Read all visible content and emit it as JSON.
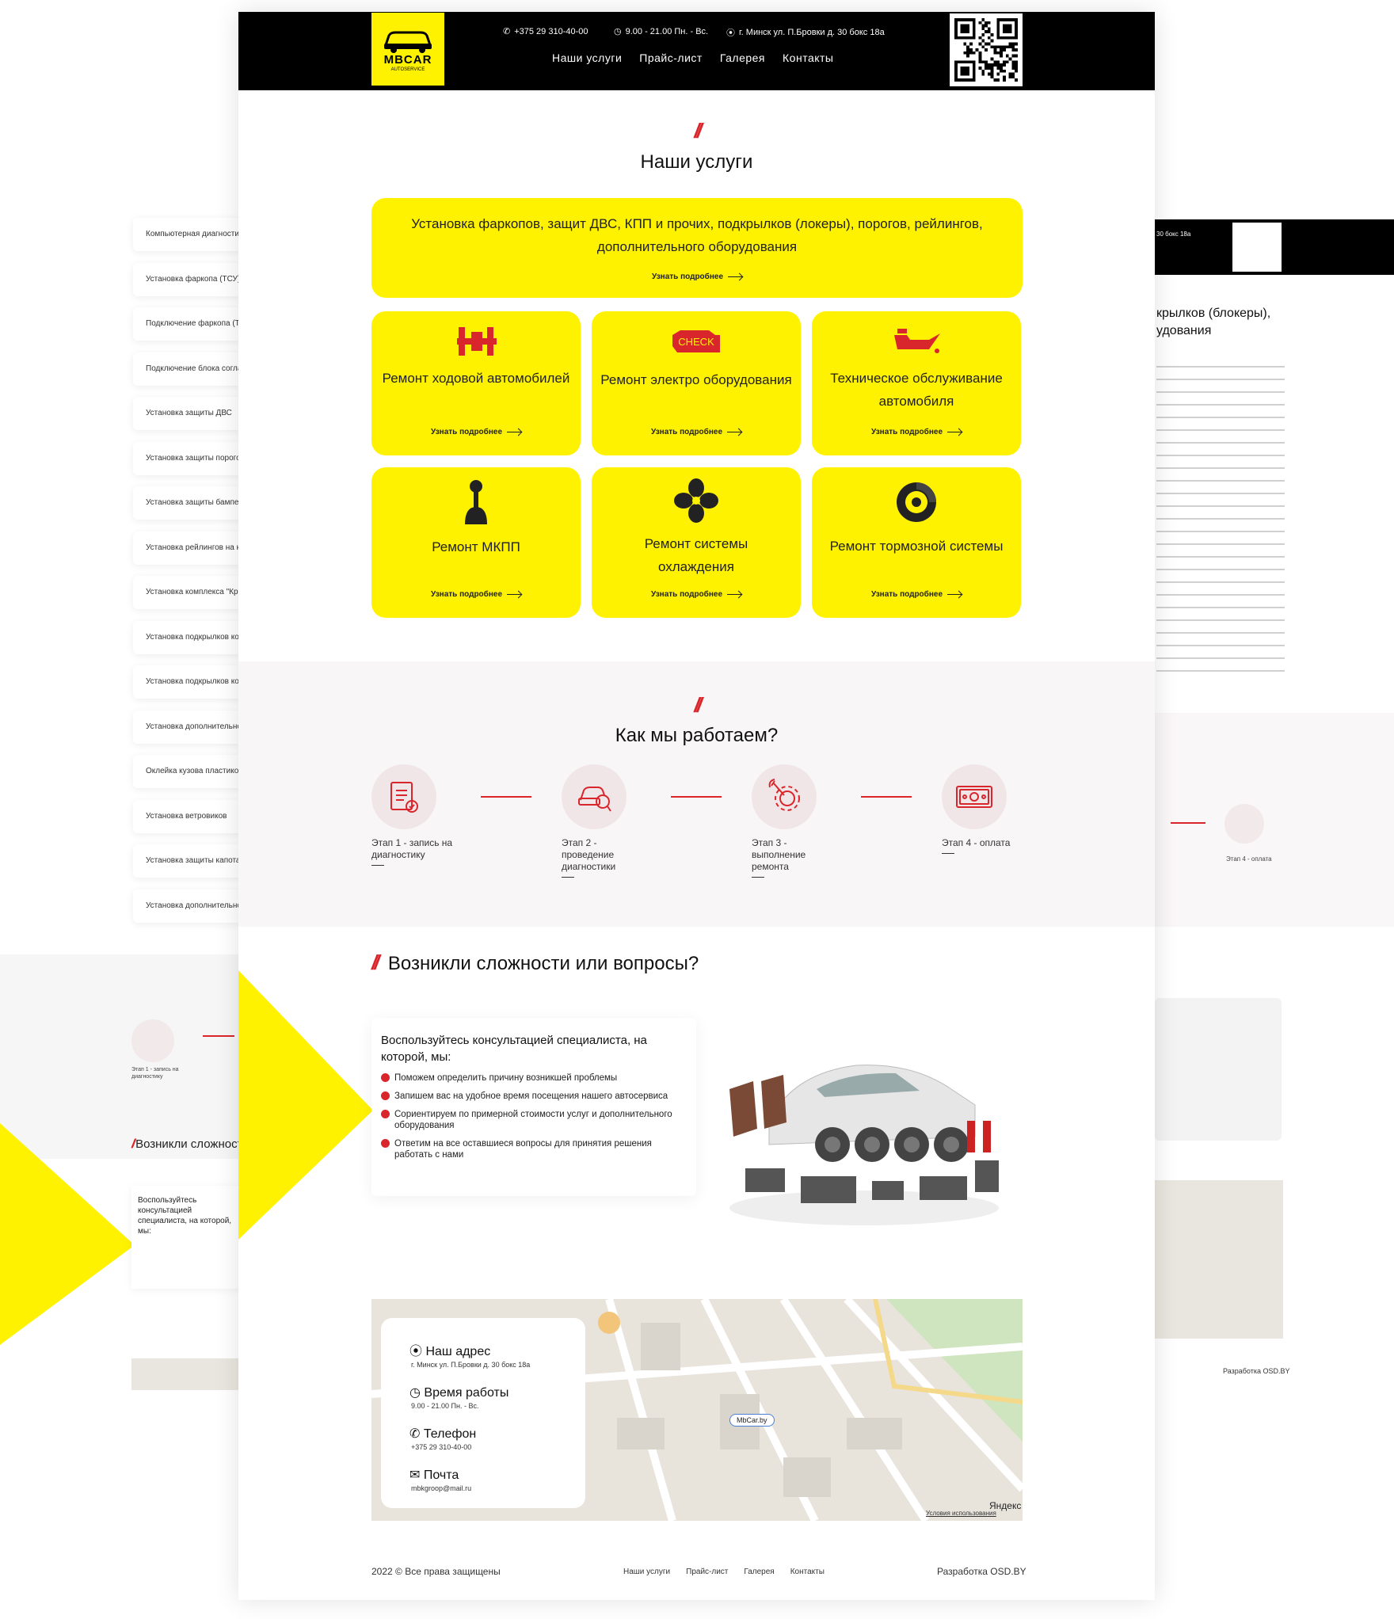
{
  "brand": {
    "name": "MBCAR",
    "sub": "AUTOSERVICE"
  },
  "header": {
    "phone": "+375 29 310-40-00",
    "hours": "9.00 - 21.00 Пн. - Вс.",
    "address": "г. Минск ул. П.Бровки д. 30 бокс 18а",
    "nav": [
      "Наши услуги",
      "Прайс-лист",
      "Галерея",
      "Контакты"
    ]
  },
  "services": {
    "title": "Наши услуги",
    "more_label": "Узнать подробнее",
    "wide_card": "Установка фаркопов, защит ДВС, КПП и прочих, подкрылков (локеры), порогов, рейлингов, дополнительного оборудования",
    "cards": [
      {
        "title": "Ремонт ходовой автомобилей",
        "icon": "suspension-icon"
      },
      {
        "title": "Ремонт электро оборудования",
        "icon": "check-engine-icon",
        "badge": "CHECK"
      },
      {
        "title": "Техническое обслуживание автомобиля",
        "icon": "oil-can-icon"
      },
      {
        "title": "Ремонт МКПП",
        "icon": "gear-shift-icon"
      },
      {
        "title": "Ремонт системы охлаждения",
        "icon": "fan-icon"
      },
      {
        "title": "Ремонт тормозной системы",
        "icon": "brake-disc-icon"
      }
    ]
  },
  "process": {
    "title": "Как мы работаем?",
    "steps": [
      {
        "label": "Этап 1 - запись на диагностику",
        "icon": "document-icon"
      },
      {
        "label": "Этап 2 - проведение диагностики",
        "icon": "car-diagnostics-icon"
      },
      {
        "label": "Этап 3 - выполнение ремонта",
        "icon": "wrench-gear-icon"
      },
      {
        "label": "Этап 4 - оплата",
        "icon": "money-icon"
      }
    ]
  },
  "questions": {
    "title": "Возникли сложности или вопросы?",
    "lead": "Воспользуйтесь консультацией специалиста, на которой, мы:",
    "items": [
      "Поможем определить причину возникшей проблемы",
      "Запишем вас на удобное время посещения нашего автосервиса",
      "Сориентируем по примерной стоимости услуг и дополнительного оборудования",
      "Ответим на все оставшиеся вопросы для принятия решения работать с нами"
    ]
  },
  "contacts": {
    "address_k": "Наш адрес",
    "address_v": "г. Минск ул. П.Бровки д. 30 бокс 18а",
    "hours_k": "Время работы",
    "hours_v": "9.00 - 21.00 Пн. - Вс.",
    "phone_k": "Телефон",
    "phone_v": "+375 29 310-40-00",
    "mail_k": "Почта",
    "mail_v": "mbkgroop@mail.ru",
    "map_pin": "MbCar.by",
    "map_brand": "Яндекс",
    "map_terms": "Условия использования"
  },
  "footer": {
    "copy": "2022 © Все права защищены",
    "nav": [
      "Наши услуги",
      "Прайс-лист",
      "Галерея",
      "Контакты"
    ],
    "dev": "Разработка OSD.BY"
  },
  "bg_left": {
    "services": [
      "Компьютерная диагностика",
      "Установка фаркопа (ТСУ)",
      "Подключение фаркопа (ТСУ)",
      "Подключение блока согласования",
      "Установка защиты ДВС",
      "Установка защиты порогов",
      "Установка защиты бампера",
      "Установка рейлингов на крышу",
      "Установка комплекса \"Кросс\"",
      "Установка подкрылков колёс",
      "Установка подкрылков колёс",
      "Установка дополнительного",
      "Оклейка кузова пластиком",
      "Установка ветровиков",
      "Установка защиты капота",
      "Установка дополнительного"
    ],
    "step_label": "Этап 1 - запись на диагностику",
    "q_title": "Возникли сложности",
    "q_lead": "Воспользуйтесь консультацией специалиста, на которой, мы:"
  },
  "bg_right": {
    "addr": "30 бокс 18а",
    "head": "крылков (блокеры), удования",
    "step": "Этап 4 - оплата",
    "dev": "Разработка OSD.BY"
  },
  "colors": {
    "accent": "#d9262c",
    "yellow": "#fff200",
    "black": "#000000"
  }
}
